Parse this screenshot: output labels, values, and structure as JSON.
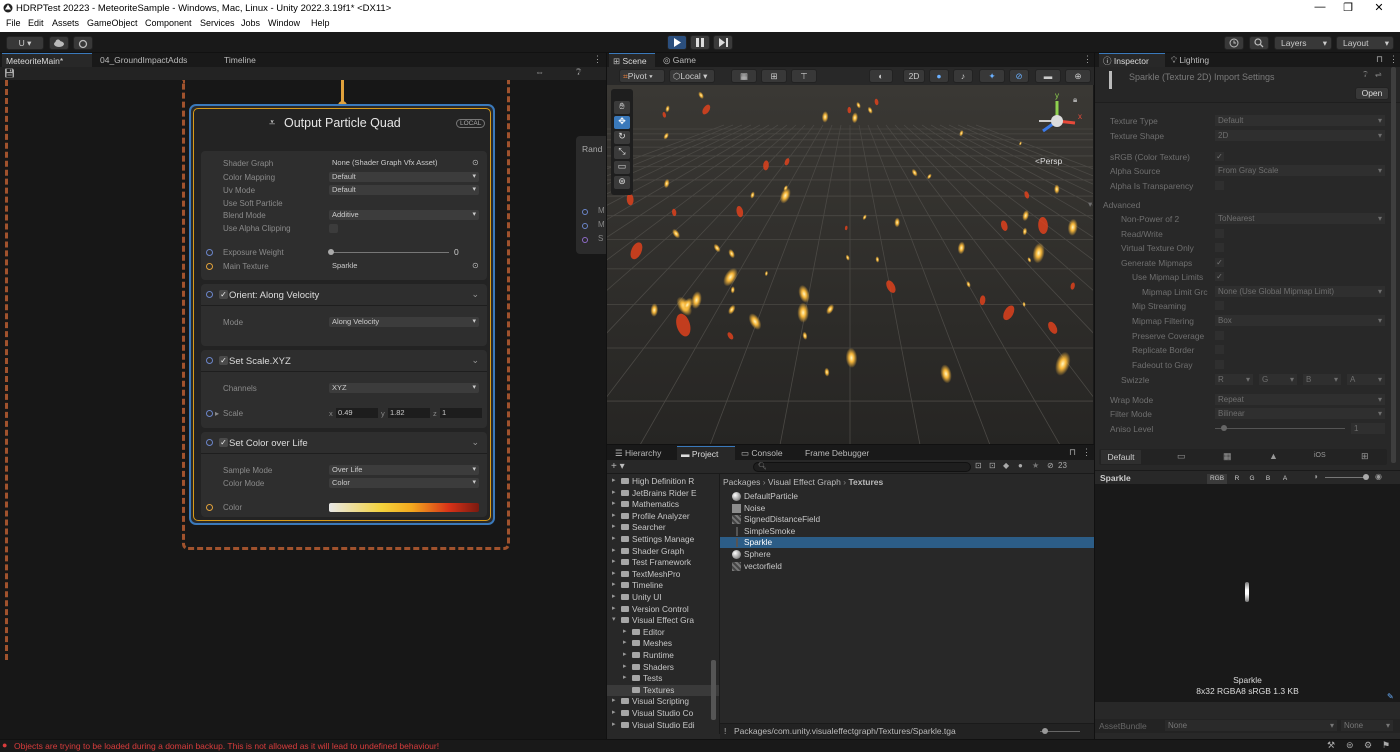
{
  "window": {
    "title": "HDRPTest 20223 - MeteoriteSample - Windows, Mac, Linux - Unity 2022.3.19f1* <DX11>",
    "controls": [
      "—",
      "❐",
      "✕"
    ]
  },
  "menu": [
    "File",
    "Edit",
    "Assets",
    "GameObject",
    "Component",
    "Services",
    "Jobs",
    "Window",
    "Help"
  ],
  "toolbar": {
    "account": "U ▾",
    "layers": "Layers",
    "layout": "Layout"
  },
  "left_tabs": [
    "MeteoriteMain*",
    "04_GroundImpactAdds",
    "Timeline"
  ],
  "vfx": {
    "node_title": "Output Particle Quad",
    "node_badge": "LOCAL",
    "side_label": "Rand",
    "side_rows": [
      "M",
      "M",
      "S"
    ],
    "settings": [
      {
        "label": "Shader Graph",
        "value": "None (Shader Graph Vfx Asset)"
      },
      {
        "label": "Color Mapping",
        "value": "Default"
      },
      {
        "label": "Uv Mode",
        "value": "Default"
      },
      {
        "label": "Use Soft Particle",
        "value": ""
      },
      {
        "label": "Blend Mode",
        "value": "Additive"
      },
      {
        "label": "Use Alpha Clipping",
        "value": ""
      }
    ],
    "exposure_label": "Exposure Weight",
    "exposure_value": "0",
    "main_texture_label": "Main Texture",
    "main_texture_value": "Sparkle",
    "blocks": {
      "orient": {
        "title": "Orient: Along Velocity",
        "mode_label": "Mode",
        "mode_value": "Along Velocity"
      },
      "scale": {
        "title": "Set Scale.XYZ",
        "channels_label": "Channels",
        "channels_value": "XYZ",
        "scale_label": "Scale",
        "x": "0.49",
        "y": "1.82",
        "z": "1"
      },
      "color": {
        "title": "Set Color over Life",
        "sample_label": "Sample Mode",
        "sample_value": "Over Life",
        "mode_label": "Color Mode",
        "mode_value": "Color",
        "color_label": "Color"
      }
    }
  },
  "scene_tabs": [
    "Scene",
    "Game"
  ],
  "scene_toolbar": {
    "pivot": "Pivot",
    "local": "Local",
    "mode2d": "2D"
  },
  "scene": {
    "persp": "<Persp",
    "gizmo_y": "y",
    "gizmo_x": "x"
  },
  "bottom_tabs": [
    "Hierarchy",
    "Project",
    "Console",
    "Frame Debugger"
  ],
  "project": {
    "count": "23",
    "breadcrumb": [
      "Packages",
      "Visual Effect Graph",
      "Textures"
    ],
    "tree": [
      {
        "name": "High Definition R",
        "indent": 0,
        "open": false
      },
      {
        "name": "JetBrains Rider E",
        "indent": 0,
        "open": false
      },
      {
        "name": "Mathematics",
        "indent": 0,
        "open": false
      },
      {
        "name": "Profile Analyzer",
        "indent": 0,
        "open": false
      },
      {
        "name": "Searcher",
        "indent": 0,
        "open": false
      },
      {
        "name": "Settings Manage",
        "indent": 0,
        "open": false
      },
      {
        "name": "Shader Graph",
        "indent": 0,
        "open": false
      },
      {
        "name": "Test Framework",
        "indent": 0,
        "open": false
      },
      {
        "name": "TextMeshPro",
        "indent": 0,
        "open": false
      },
      {
        "name": "Timeline",
        "indent": 0,
        "open": false
      },
      {
        "name": "Unity UI",
        "indent": 0,
        "open": false
      },
      {
        "name": "Version Control",
        "indent": 0,
        "open": false
      },
      {
        "name": "Visual Effect Gra",
        "indent": 0,
        "open": true
      },
      {
        "name": "Editor",
        "indent": 1,
        "open": false
      },
      {
        "name": "Meshes",
        "indent": 1,
        "open": false
      },
      {
        "name": "Runtime",
        "indent": 1,
        "open": false
      },
      {
        "name": "Shaders",
        "indent": 1,
        "open": false
      },
      {
        "name": "Tests",
        "indent": 1,
        "open": false
      },
      {
        "name": "Textures",
        "indent": 1,
        "open": false,
        "selected": true
      },
      {
        "name": "Visual Scripting",
        "indent": 0,
        "open": false
      },
      {
        "name": "Visual Studio Co",
        "indent": 0,
        "open": false
      },
      {
        "name": "Visual Studio Edi",
        "indent": 0,
        "open": false
      }
    ],
    "files": [
      {
        "name": "DefaultParticle",
        "icon": "sphere-icon"
      },
      {
        "name": "Noise",
        "icon": "noise-texture-icon"
      },
      {
        "name": "SignedDistanceField",
        "icon": "sdf-icon"
      },
      {
        "name": "SimpleSmoke",
        "icon": "texture-icon"
      },
      {
        "name": "Sparkle",
        "icon": "texture-icon",
        "selected": true
      },
      {
        "name": "Sphere",
        "icon": "sphere-icon"
      },
      {
        "name": "vectorfield",
        "icon": "sdf-icon"
      }
    ],
    "path": "Packages/com.unity.visualeffectgraph/Textures/Sparkle.tga"
  },
  "inspector": {
    "tabs": [
      "Inspector",
      "Lighting"
    ],
    "asset_title": "Sparkle (Texture 2D) Import Settings",
    "open_label": "Open",
    "rows": [
      {
        "label": "Texture Type",
        "value": "Default",
        "kind": "dd",
        "indent": 0
      },
      {
        "label": "Texture Shape",
        "value": "2D",
        "kind": "dd",
        "indent": 0
      },
      {
        "label": "sRGB (Color Texture)",
        "value": "✓",
        "kind": "cb",
        "indent": 0
      },
      {
        "label": "Alpha Source",
        "value": "From Gray Scale",
        "kind": "dd",
        "indent": 0
      },
      {
        "label": "Alpha Is Transparency",
        "value": "",
        "kind": "cb",
        "indent": 0
      },
      {
        "label": "Advanced",
        "value": "",
        "kind": "hdr",
        "indent": 0
      },
      {
        "label": "Non-Power of 2",
        "value": "ToNearest",
        "kind": "dd",
        "indent": 1
      },
      {
        "label": "Read/Write",
        "value": "",
        "kind": "cb",
        "indent": 1
      },
      {
        "label": "Virtual Texture Only",
        "value": "",
        "kind": "cb",
        "indent": 1
      },
      {
        "label": "Generate Mipmaps",
        "value": "✓",
        "kind": "cb",
        "indent": 1
      },
      {
        "label": "Use Mipmap Limits",
        "value": "✓",
        "kind": "cb",
        "indent": 2
      },
      {
        "label": "Mipmap Limit Grc",
        "value": "None (Use Global Mipmap Limit)",
        "kind": "dd",
        "indent": 3
      },
      {
        "label": "Mip Streaming",
        "value": "",
        "kind": "cb",
        "indent": 2
      },
      {
        "label": "Mipmap Filtering",
        "value": "Box",
        "kind": "dd",
        "indent": 2
      },
      {
        "label": "Preserve Coverage",
        "value": "",
        "kind": "cb",
        "indent": 2
      },
      {
        "label": "Replicate Border",
        "value": "",
        "kind": "cb",
        "indent": 2
      },
      {
        "label": "Fadeout to Gray",
        "value": "",
        "kind": "cb",
        "indent": 2
      },
      {
        "label": "Swizzle",
        "value": "",
        "kind": "swz",
        "indent": 1
      },
      {
        "label": "Wrap Mode",
        "value": "Repeat",
        "kind": "dd",
        "indent": 0
      },
      {
        "label": "Filter Mode",
        "value": "Bilinear",
        "kind": "dd",
        "indent": 0
      },
      {
        "label": "Aniso Level",
        "value": "1",
        "kind": "slider",
        "indent": 0
      }
    ],
    "swizzle": [
      "R",
      "G",
      "B",
      "A"
    ],
    "platform_tabs": [
      "Default",
      "iOS"
    ],
    "preview_name": "Sparkle",
    "preview_channels": [
      "RGB",
      "R",
      "G",
      "B",
      "A"
    ],
    "preview_label": "Sparkle",
    "preview_info": "8x32  RGBA8 sRGB  1.3 KB",
    "assetbundle_label": "AssetBundle",
    "assetbundle_value": "None",
    "assetbundle_variant": "None"
  },
  "status": {
    "message": "Objects are trying to be loaded during a domain backup. This is not allowed as it will lead to undefined behaviour!"
  },
  "colors": {
    "accent": "#3a79bb",
    "node_orange": "#d89c1a",
    "error": "#d83c3c",
    "selection": "#2c5d87"
  }
}
